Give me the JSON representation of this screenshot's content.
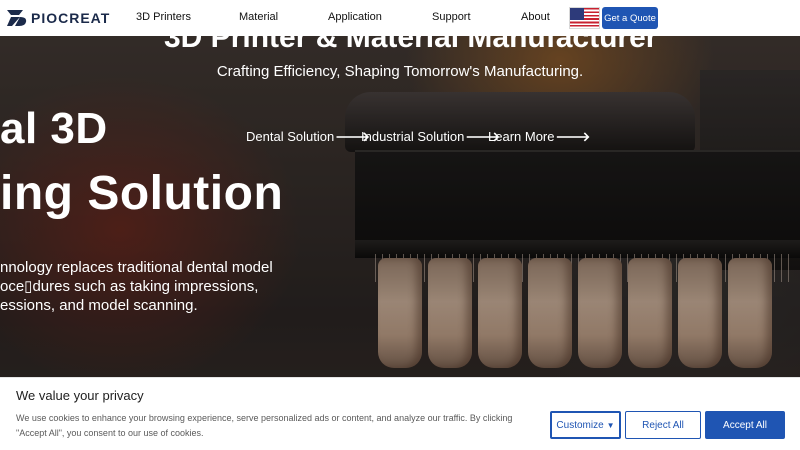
{
  "nav": {
    "brand": "PIOCREAT",
    "items": [
      {
        "label": "3D Printers"
      },
      {
        "label": "Material"
      },
      {
        "label": "Application"
      },
      {
        "label": "Support"
      },
      {
        "label": "About"
      }
    ],
    "flag_icon": "us-flag-icon",
    "quote_label": "Get a Quote"
  },
  "hero": {
    "headline": "3D Printer & Material Manufacturer",
    "tagline": "Crafting Efficiency, Shaping Tomorrow's Manufacturing.",
    "links": [
      {
        "label": "Dental Solution",
        "arrow": "🡒"
      },
      {
        "label": "Industrial Solution",
        "arrow": "🡒"
      },
      {
        "label": "Learn More",
        "arrow": "🡒"
      }
    ],
    "slide_title_line1": "al 3D",
    "slide_title_line2": "ing Solution",
    "slide_paragraph": [
      "nnology replaces traditional dental model",
      "oce▯dures such as taking impressions,",
      "essions, and model scanning."
    ]
  },
  "cookie": {
    "title": "We value your privacy",
    "text_line1": "We use cookies to enhance your browsing experience, serve personalized ads or content, and analyze our traffic. By clicking",
    "text_line2": "\"Accept All\", you consent to our use of cookies.",
    "customize_label": "Customize",
    "customize_caret": "▼",
    "reject_label": "Reject All",
    "accept_label": "Accept All"
  },
  "colors": {
    "accent": "#1f55b3",
    "nav_bg": "#ffffff",
    "brand_text": "#1b2a4a"
  }
}
